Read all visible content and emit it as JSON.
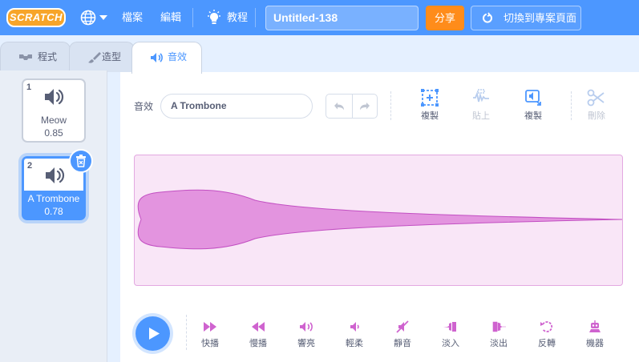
{
  "menubar": {
    "logo": "SCRATCH",
    "file_label": "檔案",
    "edit_label": "編輯",
    "tutorials_label": "教程",
    "project_title": "Untitled-138",
    "share_label": "分享",
    "see_project_page_label": "切換到專案頁面",
    "icons": [
      "globe-icon",
      "chevron-down-icon",
      "lightbulb-icon",
      "project-page-icon"
    ]
  },
  "tabs": [
    {
      "label": "程式",
      "icon": "code-icon",
      "active": false
    },
    {
      "label": "造型",
      "icon": "brush-icon",
      "active": false
    },
    {
      "label": "音效",
      "icon": "speaker-icon",
      "active": true
    }
  ],
  "sounds": [
    {
      "number": "1",
      "name": "Meow",
      "duration": "0.85",
      "selected": false
    },
    {
      "number": "2",
      "name": "A Trombone",
      "duration": "0.78",
      "selected": true
    }
  ],
  "editor": {
    "sound_label": "音效",
    "sound_name": "A Trombone",
    "tools": [
      {
        "label": "複製",
        "icon": "copy-selection-icon",
        "disabled": false
      },
      {
        "label": "貼上",
        "icon": "paste-icon",
        "disabled": true
      },
      {
        "label": "複製",
        "icon": "copy-to-new-icon",
        "disabled": false
      },
      {
        "label": "刪除",
        "icon": "scissors-icon",
        "disabled": true
      }
    ],
    "waveform_color": "#cf63cf",
    "waveform_bg": "#f9e6f7"
  },
  "effects": [
    {
      "label": "快播",
      "icon": "faster-icon"
    },
    {
      "label": "慢播",
      "icon": "slower-icon"
    },
    {
      "label": "響亮",
      "icon": "louder-icon"
    },
    {
      "label": "輕柔",
      "icon": "softer-icon"
    },
    {
      "label": "靜音",
      "icon": "mute-icon"
    },
    {
      "label": "淡入",
      "icon": "fade-in-icon"
    },
    {
      "label": "淡出",
      "icon": "fade-out-icon"
    },
    {
      "label": "反轉",
      "icon": "reverse-icon"
    },
    {
      "label": "機器",
      "icon": "robot-icon"
    }
  ],
  "colors": {
    "accent": "#4c97ff",
    "share": "#ff8c1a",
    "sound": "#cf63cf"
  }
}
